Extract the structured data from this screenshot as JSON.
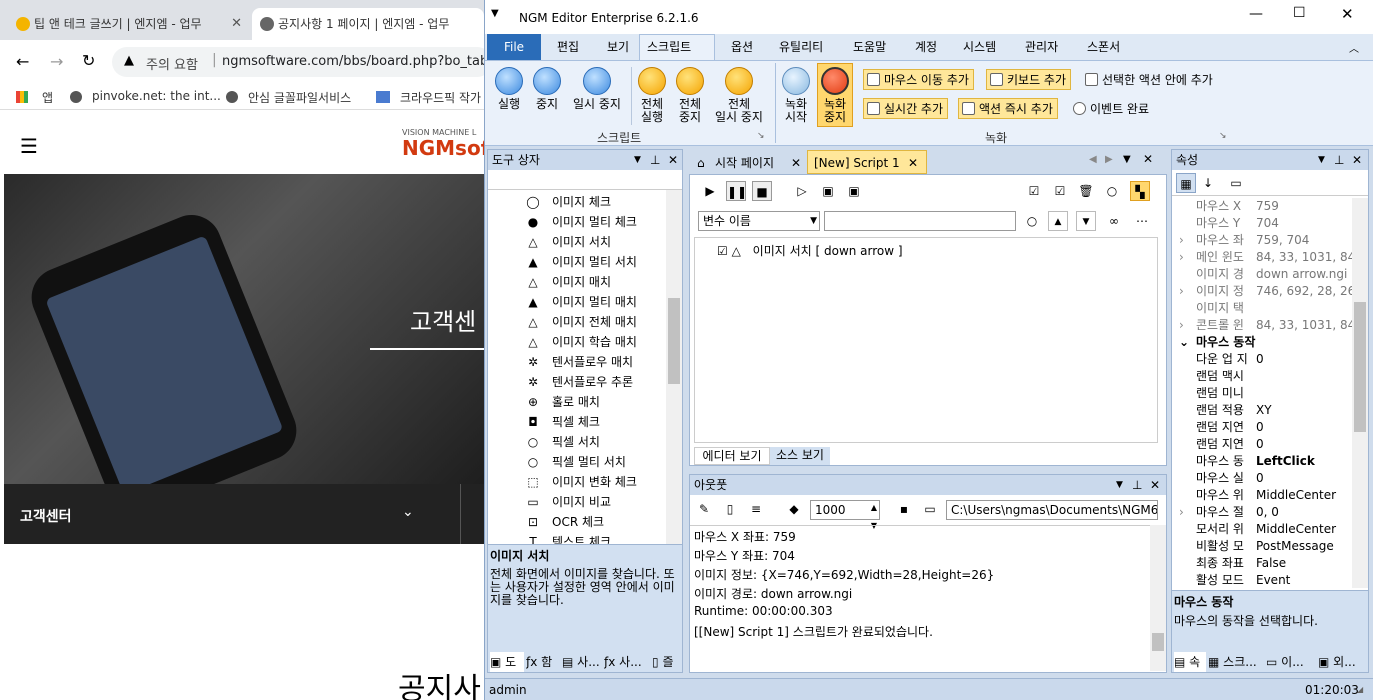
{
  "browser": {
    "tabs": [
      {
        "label": "팁 앤 테크 글쓰기 | 엔지엠 - 업무"
      },
      {
        "label": "공지사항 1 페이지 | 엔지엠 - 업무"
      }
    ],
    "address": {
      "security": "주의 요함",
      "url": "ngmsoftware.com/bbs/board.php?bo_tab"
    },
    "bookmarks": [
      "앱",
      "pinvoke.net: the int...",
      "안심 글꼴파일서비스",
      "크라우드픽 작가"
    ],
    "site": {
      "logo_small": "VISION MACHINE L",
      "logo_main": "NGMsoftw",
      "hero_text": "고객센",
      "nav_label": "고객센터",
      "section_title": "공지사"
    }
  },
  "app": {
    "title": "NGM Editor",
    "edition": "Enterprise 6.2.1.6",
    "menu": [
      "File",
      "편집",
      "보기",
      "스크립트",
      "옵션",
      "유틸리티",
      "도움말",
      "계정",
      "시스템",
      "관리자",
      "스폰서"
    ],
    "ribbon": {
      "script_group": "스크립트",
      "record_group": "녹화",
      "buttons": {
        "run": "실행",
        "stop": "중지",
        "pause": "일시 중지",
        "run_all_1": "전체",
        "run_all_2": "실행",
        "stop_all_1": "전체",
        "stop_all_2": "중지",
        "pause_all_1": "전체",
        "pause_all_2": "일시 중지",
        "rec_start_1": "녹화",
        "rec_start_2": "시작",
        "rec_stop_1": "녹화",
        "rec_stop_2": "중지",
        "add_mouse": "마우스 이동 추가",
        "add_keyboard": "키보드 추가",
        "add_in_selected": "선택한 액션 안에 추가",
        "add_realtime": "실시간 추가",
        "add_action_now": "액션 즉시 추가",
        "event_done": "이벤트 완료"
      }
    },
    "toolbox": {
      "title": "도구 상자",
      "items": [
        "이미지 체크",
        "이미지 멀티 체크",
        "이미지 서치",
        "이미지 멀티 서치",
        "이미지 매치",
        "이미지 멀티 매치",
        "이미지 전체 매치",
        "이미지 학습 매치",
        "텐서플로우 매치",
        "텐서플로우 추론",
        "홀로 매치",
        "픽셀 체크",
        "픽셀 서치",
        "픽셀 멀티 서치",
        "이미지 변화 체크",
        "이미지 비교",
        "OCR 체크",
        "텍스트 체크"
      ],
      "desc_title": "이미지 서치",
      "desc_text": "전체 화면에서 이미지를 찾습니다. 또는 사용자가 설정한 영역 안에서 이미지를 찾습니다.",
      "bottom_tabs": [
        "도",
        "함",
        "사...",
        "사...",
        "즐"
      ]
    },
    "editor": {
      "tabs": [
        "시작 페이지",
        "[New] Script 1"
      ],
      "var_placeholder": "변수 이름",
      "script_item": "이미지 서치 [ down arrow ]",
      "view_tabs": [
        "에디터 보기",
        "소스 보기"
      ]
    },
    "output": {
      "title": "아웃풋",
      "count": "1000",
      "path": "C:\\Users\\ngmas\\Documents\\NGM6\\",
      "lines": [
        "마우스 X 좌표: 759",
        "마우스 Y 좌표: 704",
        "이미지 정보: {X=746,Y=692,Width=28,Height=26}",
        "이미지 경로: down arrow.ngi",
        "Runtime: 00:00:00.303",
        "[[New] Script 1] 스크립트가 완료되었습니다."
      ]
    },
    "properties": {
      "title": "속성",
      "rows": [
        {
          "k": "마우스 X",
          "v": "759",
          "ex": ""
        },
        {
          "k": "마우스 Y",
          "v": "704",
          "ex": ""
        },
        {
          "k": "마우스 좌",
          "v": "759, 704",
          "ex": "›"
        },
        {
          "k": "메인 윈도",
          "v": "84, 33, 1031, 847",
          "ex": "›"
        },
        {
          "k": "이미지 경",
          "v": "down arrow.ngi",
          "ex": ""
        },
        {
          "k": "이미지 정",
          "v": "746, 692, 28, 26",
          "ex": "›"
        },
        {
          "k": "이미지 택",
          "v": "",
          "ex": ""
        },
        {
          "k": "콘트롤 윈",
          "v": "84, 33, 1031, 847",
          "ex": "›"
        },
        {
          "k": "마우스 동작",
          "v": "",
          "ex": "⌄"
        },
        {
          "k": "다운 업 지",
          "v": "0",
          "ex": ""
        },
        {
          "k": "랜덤 맥시",
          "v": "",
          "ex": ""
        },
        {
          "k": "랜덤 미니",
          "v": "",
          "ex": ""
        },
        {
          "k": "랜덤 적용",
          "v": "XY",
          "ex": ""
        },
        {
          "k": "랜덤 지연",
          "v": "0",
          "ex": ""
        },
        {
          "k": "랜덤 지연",
          "v": "0",
          "ex": ""
        },
        {
          "k": "마우스 동",
          "v": "LeftClick",
          "ex": ""
        },
        {
          "k": "마우스 실",
          "v": "0",
          "ex": ""
        },
        {
          "k": "마우스 위",
          "v": "MiddleCenter",
          "ex": ""
        },
        {
          "k": "마우스 절",
          "v": "0, 0",
          "ex": "›"
        },
        {
          "k": "모서리 위",
          "v": "MiddleCenter",
          "ex": ""
        },
        {
          "k": "비활성 모",
          "v": "PostMessage",
          "ex": ""
        },
        {
          "k": "최종 좌표",
          "v": "False",
          "ex": ""
        },
        {
          "k": "활성 모드",
          "v": "Event",
          "ex": ""
        }
      ],
      "desc_title": "마우스 동작",
      "desc_text": "마우스의 동작을 선택합니다.",
      "bottom_tabs": [
        "속",
        "스크...",
        "이...",
        "외..."
      ]
    },
    "status": {
      "user": "admin",
      "time": "01:20:03"
    },
    "colors": {
      "accent": "#2a6cb8",
      "ribbon": "#eaf1fa",
      "highlight": "#ffe79a"
    }
  }
}
